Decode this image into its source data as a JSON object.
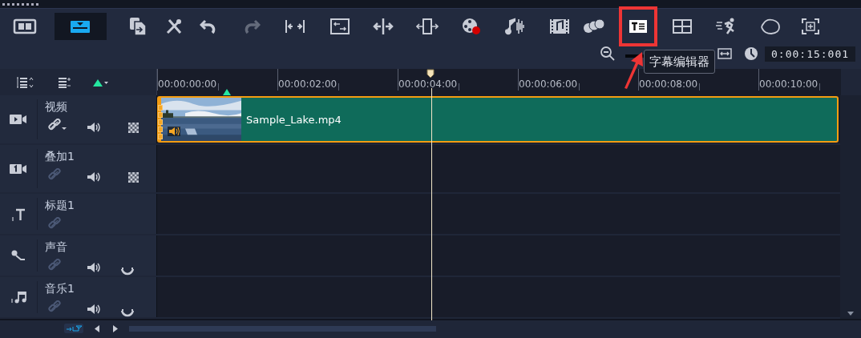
{
  "toolbar": {
    "buttons": [
      {
        "kind": "storyboard",
        "selected": false,
        "highlighted": false
      },
      {
        "kind": "timeline",
        "selected": true,
        "highlighted": false
      },
      {
        "kind": "copy",
        "selected": false,
        "highlighted": false
      },
      {
        "kind": "tools",
        "selected": false,
        "highlighted": false
      },
      {
        "kind": "undo",
        "selected": false,
        "highlighted": false,
        "disabled": false
      },
      {
        "kind": "redo",
        "selected": false,
        "highlighted": false,
        "disabled": true
      },
      {
        "kind": "fit",
        "selected": false,
        "highlighted": false
      },
      {
        "kind": "resize",
        "selected": false,
        "highlighted": false
      },
      {
        "kind": "split",
        "selected": false,
        "highlighted": false
      },
      {
        "kind": "insert",
        "selected": false,
        "highlighted": false
      },
      {
        "kind": "record",
        "selected": false,
        "highlighted": false
      },
      {
        "kind": "audio",
        "selected": false,
        "highlighted": false
      },
      {
        "kind": "music",
        "selected": false,
        "highlighted": false
      },
      {
        "kind": "blend",
        "selected": false,
        "highlighted": false
      },
      {
        "kind": "subtitle",
        "selected": false,
        "highlighted": true
      },
      {
        "kind": "grid",
        "selected": false,
        "highlighted": false
      },
      {
        "kind": "speed",
        "selected": false,
        "highlighted": false
      },
      {
        "kind": "mask",
        "selected": false,
        "highlighted": false
      },
      {
        "kind": "track",
        "selected": false,
        "highlighted": false
      }
    ]
  },
  "tooltip": "字幕编辑器",
  "zoom_slider": {
    "level": 1
  },
  "timecode": "0:00:15:001",
  "ruler": {
    "labels": [
      "00:00:00:00",
      "00:00:02:00",
      "00:00:04:00",
      "00:00:06:00",
      "00:00:08:00",
      "00:00:10:00"
    ]
  },
  "tracks": [
    {
      "kind": "video",
      "name": "视频",
      "link_enabled": true,
      "clip": {
        "title": "Sample_Lake.mp4"
      }
    },
    {
      "kind": "overlay",
      "name": "叠加1",
      "link_enabled": false
    },
    {
      "kind": "title",
      "name": "标题1",
      "link_enabled": false
    },
    {
      "kind": "voice",
      "name": "声音",
      "link_enabled": false
    },
    {
      "kind": "music",
      "name": "音乐1",
      "link_enabled": false
    }
  ]
}
